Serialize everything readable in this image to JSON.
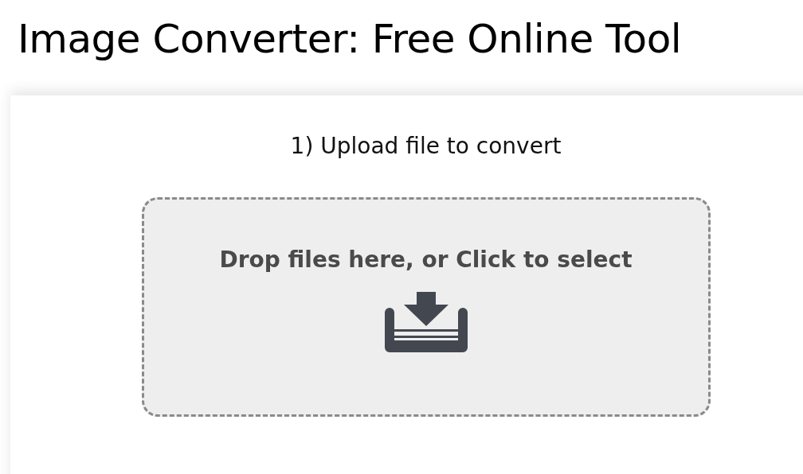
{
  "page_title": "Image Converter: Free Online Tool",
  "step": {
    "label": "1) Upload file to convert"
  },
  "dropzone": {
    "prompt": "Drop files here, or Click to select"
  }
}
